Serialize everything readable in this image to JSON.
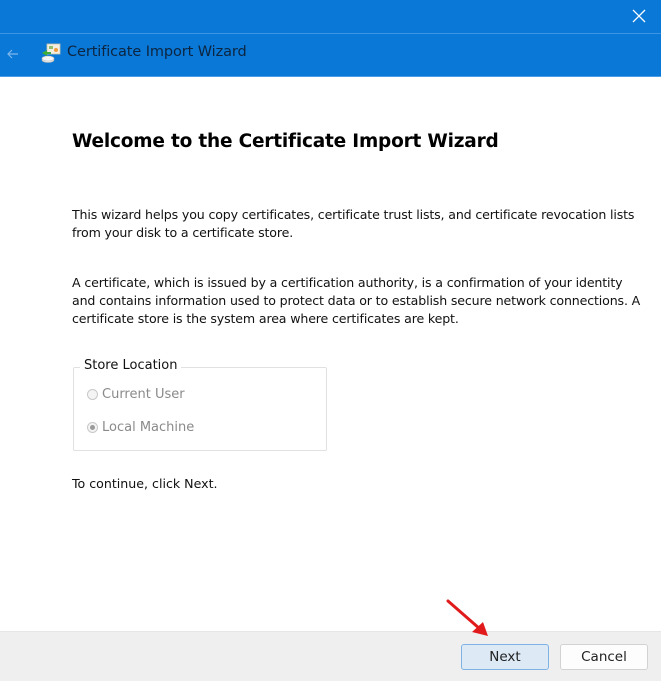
{
  "window": {
    "title": "Certificate Import Wizard",
    "close_icon": "close-icon",
    "back_icon": "back-arrow-icon",
    "app_icon": "certificate-wizard-icon",
    "accent_color": "#0a78d7"
  },
  "content": {
    "heading": "Welcome to the Certificate Import Wizard",
    "paragraph1": "This wizard helps you copy certificates, certificate trust lists, and certificate revocation lists from your disk to a certificate store.",
    "paragraph2": "A certificate, which is issued by a certification authority, is a confirmation of your identity and contains information used to protect data or to establish secure network connections. A certificate store is the system area where certificates are kept.",
    "store_location": {
      "label": "Store Location",
      "options": [
        {
          "label": "Current User",
          "selected": false,
          "enabled": false
        },
        {
          "label": "Local Machine",
          "selected": true,
          "enabled": false
        }
      ]
    },
    "instruction": "To continue, click Next."
  },
  "footer": {
    "next_label": "Next",
    "cancel_label": "Cancel"
  },
  "annotation": {
    "type": "red-arrow",
    "target": "next-button",
    "color": "#e11b1b"
  }
}
